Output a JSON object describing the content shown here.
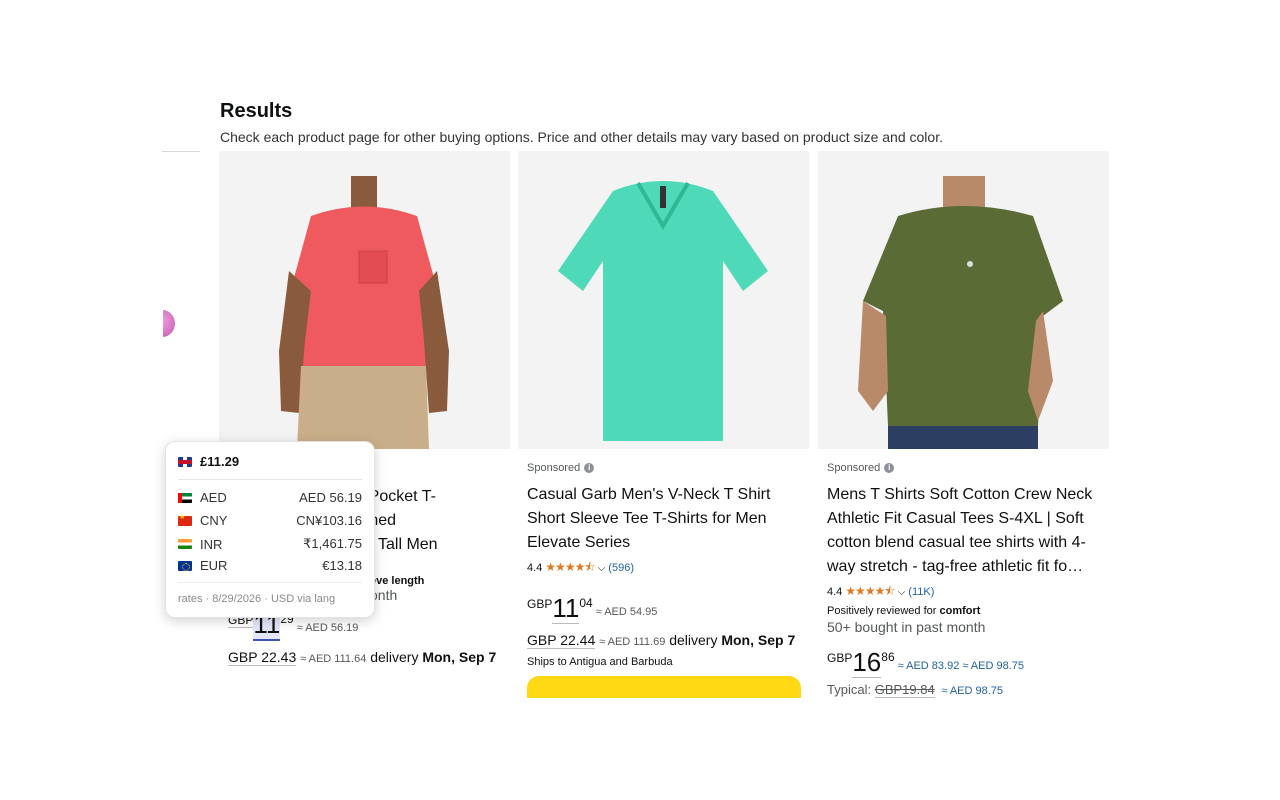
{
  "header": {
    "title": "Results",
    "subtitle": "Check each product page for other buying options. Price and other details may vary based on product size and color."
  },
  "popup": {
    "main_price": "£11.29",
    "rates": [
      {
        "flag": "uae-flag-icon",
        "code": "AED",
        "value": "AED 56.19"
      },
      {
        "flag": "china-flag-icon",
        "code": "CNY",
        "value": "CN¥103.16"
      },
      {
        "flag": "india-flag-icon",
        "code": "INR",
        "value": "₹1,461.75"
      },
      {
        "flag": "eu-flag-icon",
        "code": "EUR",
        "value": "€13.18"
      }
    ],
    "footer": "rates · 8/29/2026 · USD via lang"
  },
  "products": [
    {
      "title_fragments": [
        "c Fit Pocket T-",
        "esigned",
        "Tall Men"
      ],
      "extra_line": "eve length",
      "bought_fragment": "onth",
      "price": {
        "currency": "GBP",
        "whole": "11",
        "fraction": "29",
        "approx": "≈ AED 56.19"
      },
      "delivery": {
        "list_price": "GBP 22.43",
        "approx": "≈ AED 111.64",
        "label": "delivery",
        "date": "Mon, Sep 7"
      }
    },
    {
      "sponsored": "Sponsored",
      "title": "Casual Garb Men's V-Neck T Shirt Short Sleeve Tee T-Shirts for Men Elevate Series",
      "rating": "4.4",
      "stars": "★★★★⯪",
      "review_count": "(596)",
      "price": {
        "currency": "GBP",
        "whole": "11",
        "fraction": "04",
        "approx": "≈ AED 54.95"
      },
      "delivery": {
        "list_price": "GBP 22.44",
        "approx": "≈ AED 111.69",
        "label": "delivery",
        "date": "Mon, Sep 7"
      },
      "ships": "Ships to Antigua and Barbuda"
    },
    {
      "sponsored": "Sponsored",
      "title": "Mens T Shirts Soft Cotton Crew Neck Athletic Fit Casual Tees S-4XL | Soft cotton blend casual tee shirts with 4-way stretch - tag-free athletic fit fo…",
      "rating": "4.4",
      "stars": "★★★★⯪",
      "review_count": "(11K)",
      "review_note_prefix": "Positively reviewed for",
      "review_note_term": "comfort",
      "bought": "50+ bought in past month",
      "price": {
        "currency": "GBP",
        "whole": "16",
        "fraction": "86",
        "approx": "≈ AED 83.92",
        "approx2": "≈ AED 98.75"
      },
      "typical": {
        "label": "Typical:",
        "price": "GBP19.84",
        "approx": "≈ AED 98.75"
      }
    }
  ],
  "colors": {
    "star": "#de7921",
    "link": "#2162a1",
    "cart_button": "#ffd814",
    "shirt_red": "#ee5a5e",
    "shirt_mint": "#4ed9b8",
    "shirt_olive": "#5b6b36"
  }
}
